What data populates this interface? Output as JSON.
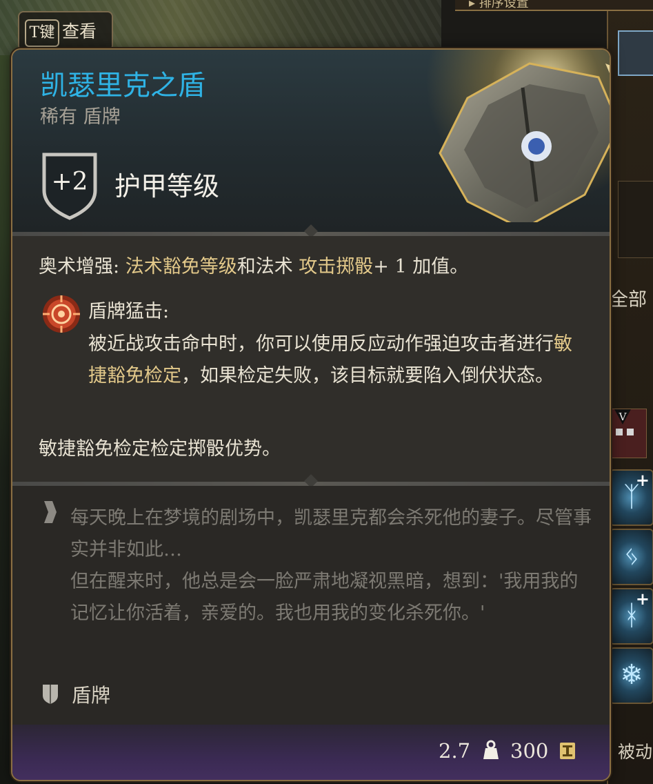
{
  "background": {
    "sort_bar_label": "▸ 排序设置",
    "all_tab": "全部",
    "passive_tab": "被动",
    "v_marker": "V",
    "hint_key": "T键",
    "hint_text": "查看"
  },
  "item": {
    "name": "凯瑟里克之盾",
    "subtitle": "稀有 盾牌",
    "ac_bonus": "+2",
    "ac_label": "护甲等级"
  },
  "properties": {
    "arcane_label": "奥术增强:",
    "arcane_gold1": " 法术豁免等级",
    "arcane_mid": "和法术",
    "arcane_gold2": " 攻击掷骰",
    "arcane_tail": "+ 1 加值。",
    "ability_title": "盾牌猛击:",
    "ability_desc_1": "被近战攻击命中时，你可以使用反应动作强迫攻击者进行",
    "ability_desc_gold": "敏捷豁免检定",
    "ability_desc_2": "，如果检定失败，该目标就要陷入倒伏状态。",
    "advantage": "敏捷豁免检定检定掷骰优势。"
  },
  "lore": {
    "line1": "每天晚上在梦境的剧场中，凯瑟里克都会杀死他的妻子。尽管事实并非如此…",
    "line2": "但在醒来时，他总是会一脸严肃地凝视黑暗，想到：'我用我的记忆让你活着，亲爱的。我也用我的变化杀死你。'"
  },
  "item_type": "盾牌",
  "footer": {
    "weight": "2.7",
    "value": "300"
  },
  "colors": {
    "name": "#2fb3e5",
    "highlight": "#e3c98a",
    "lore_text": "#7d7a73",
    "border": "#8b6f43",
    "footer_purple": "#432f5e"
  },
  "icons": [
    "shield-badge-icon",
    "shield-bash-icon",
    "quote-icon",
    "shield-type-icon",
    "weight-icon",
    "gold-coin-icon"
  ]
}
